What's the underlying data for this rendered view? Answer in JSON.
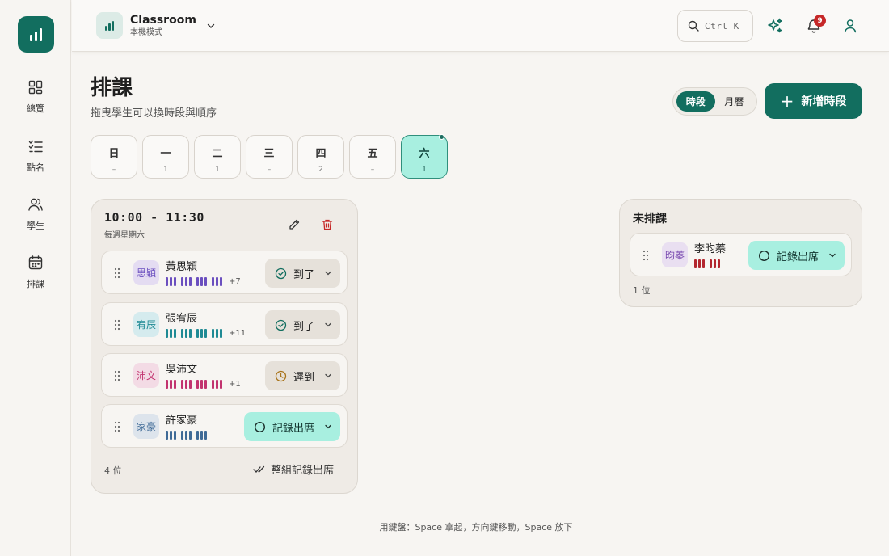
{
  "colors": {
    "accent": "#126e5f",
    "active_tab": "#a8efe0",
    "danger": "#c62828"
  },
  "sidebar": {
    "items": [
      {
        "icon": "grid-icon",
        "label": "總覽"
      },
      {
        "icon": "checklist-icon",
        "label": "點名"
      },
      {
        "icon": "users-icon",
        "label": "學生"
      },
      {
        "icon": "calendar-icon",
        "label": "排課"
      }
    ]
  },
  "header": {
    "app_name": "Classroom",
    "app_mode": "本機模式",
    "search_shortcut": "Ctrl K",
    "notification_count": "9"
  },
  "page": {
    "title": "排課",
    "subtitle": "拖曳學生可以換時段與順序",
    "view_toggle": [
      "時段",
      "月曆"
    ],
    "view_active": "時段",
    "add_button": "新增時段"
  },
  "days": [
    {
      "name": "日",
      "count": "–"
    },
    {
      "name": "一",
      "count": "1"
    },
    {
      "name": "二",
      "count": "1"
    },
    {
      "name": "三",
      "count": "–"
    },
    {
      "name": "四",
      "count": "2"
    },
    {
      "name": "五",
      "count": "–"
    },
    {
      "name": "六",
      "count": "1"
    }
  ],
  "active_day": "六",
  "slot": {
    "time": "10:00 - 11:30",
    "recurrence": "每週星期六",
    "count": "4 位",
    "bulk_action": "整組記錄出席",
    "students": [
      {
        "avatar": "思穎",
        "name": "黃思穎",
        "status": "到了",
        "extra": "+7",
        "color": "#6b4fbf",
        "avatar_bg": "#e4dcf2"
      },
      {
        "avatar": "宥辰",
        "name": "張宥辰",
        "status": "到了",
        "extra": "+11",
        "color": "#1f8a94",
        "avatar_bg": "#d5ebee"
      },
      {
        "avatar": "沛文",
        "name": "吳沛文",
        "status": "遲到",
        "extra": "+1",
        "color": "#c2336f",
        "avatar_bg": "#f3dbe5"
      },
      {
        "avatar": "家豪",
        "name": "許家豪",
        "status": "記錄出席",
        "extra": "",
        "color": "#3f6a96",
        "avatar_bg": "#dde4ec"
      }
    ]
  },
  "unscheduled": {
    "title": "未排課",
    "count": "1 位",
    "students": [
      {
        "avatar": "昀蓁",
        "name": "李昀蓁",
        "status": "記錄出席",
        "color": "#b3262e",
        "avatar_bg": "#e9dff1"
      }
    ]
  },
  "footer_hint": "用鍵盤：Space 拿起，方向鍵移動，Space 放下"
}
